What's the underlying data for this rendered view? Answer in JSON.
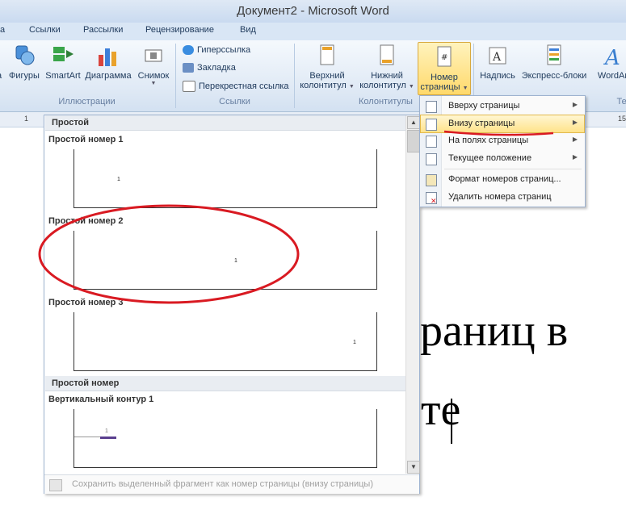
{
  "window": {
    "title": "Документ2  -  Microsoft Word"
  },
  "tabs": [
    {
      "label": "а"
    },
    {
      "label": "Ссылки"
    },
    {
      "label": "Рассылки"
    },
    {
      "label": "Рецензирование"
    },
    {
      "label": "Вид"
    }
  ],
  "ribbon": {
    "illustrations": {
      "group_label": "Иллюстрации",
      "buttons": [
        {
          "label": "а"
        },
        {
          "label": "Фигуры"
        },
        {
          "label": "SmartArt"
        },
        {
          "label": "Диаграмма"
        },
        {
          "label": "Снимок"
        }
      ]
    },
    "links": {
      "group_label": "Ссылки",
      "items": [
        {
          "label": "Гиперссылка"
        },
        {
          "label": "Закладка"
        },
        {
          "label": "Перекрестная ссылка"
        }
      ]
    },
    "headers_footers": {
      "group_label": "Колонтитулы",
      "header_label_1": "Верхний",
      "header_label_2": "колонтитул",
      "footer_label_1": "Нижний",
      "footer_label_2": "колонтитул",
      "page_number_label_1": "Номер",
      "page_number_label_2": "страницы"
    },
    "text": {
      "group_label": "Тек",
      "textbox_label": "Надпись",
      "quickparts_label": "Экспресс-блоки",
      "wordart_label": "WordArt"
    }
  },
  "ruler": {
    "left_mark": "1",
    "right_mark": "15"
  },
  "document": {
    "line1": "раниц в",
    "line2": "те"
  },
  "gallery": {
    "section1": "Простой",
    "item1": "Простой номер 1",
    "item2": "Простой номер 2",
    "item3": "Простой номер 3",
    "section2": "Простой номер",
    "item4": "Вертикальный контур 1",
    "page_num": "1",
    "footer_text": "Сохранить выделенный фрагмент как номер страницы (внизу страницы)"
  },
  "menu": {
    "items": [
      {
        "label": "Вверху страницы"
      },
      {
        "label": "Внизу страницы"
      },
      {
        "label": "На полях страницы"
      },
      {
        "label": "Текущее положение"
      },
      {
        "label": "Формат номеров страниц..."
      },
      {
        "label": "Удалить номера страниц"
      }
    ]
  },
  "annotation_colors": {
    "circle": "#d91a22",
    "underline": "#d91a22",
    "accent": "#ffd96b"
  }
}
